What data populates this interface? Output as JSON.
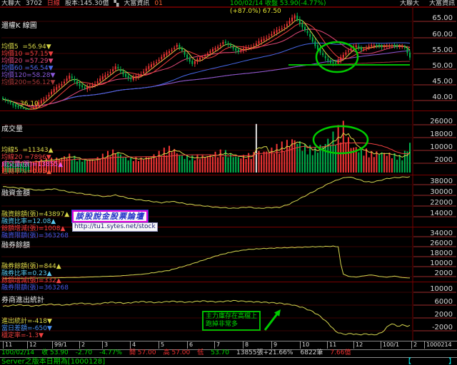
{
  "title_bar": {
    "stock_name": "大聯大",
    "stock_code": "3702",
    "period": "日線",
    "capital": "股本:145.30億",
    "vendor": "大富資訊",
    "session": "01",
    "date_close": "100/02/14 收盤 53.90(-4.77%)",
    "right_stock": "大聯大",
    "right_vendor": "大富資訊"
  },
  "main_panel": {
    "title": "還權K 線圖",
    "high_label": "(+87.0%) 67.50",
    "low_label": "36.10",
    "legend": [
      {
        "text": "均價5  =56.94▼",
        "color": "#d8d848"
      },
      {
        "text": "均價10 =57.15▼",
        "color": "#f04040"
      },
      {
        "text": "均價20 =57.29▼",
        "color": "#e04878"
      },
      {
        "text": "均價60 =56.54▼",
        "color": "#4868e8"
      },
      {
        "text": "均價120=58.28▼",
        "color": "#8858d8"
      },
      {
        "text": "均價200=56.12▼",
        "color": "#a83838"
      }
    ],
    "axis_labels": [
      "65.00",
      "60.00",
      "55.00",
      "50.00",
      "45.00",
      "40.00"
    ]
  },
  "volume_panel": {
    "title": "成交量",
    "legend": [
      {
        "text": "均線5  =11343▲",
        "color": "#d8d848"
      },
      {
        "text": "均線20 =7896▼",
        "color": "#f04040"
      },
      {
        "text": "成交量(張)=13855▲",
        "color": "#e858e8"
      },
      {
        "text": "週轉率%=0.95▲",
        "color": "#f05838"
      }
    ],
    "axis_labels": [
      "26000",
      "18000",
      "10000",
      "2000"
    ]
  },
  "margin_panel": {
    "title": "融資金額",
    "legend": [
      {
        "text": "融資餘額(張)=43897▲",
        "color": "#d8d848"
      },
      {
        "text": "融資比率=12.08▲",
        "color": "#58c8f0"
      },
      {
        "text": "餘額增減(張)=1008▲",
        "color": "#f04040"
      },
      {
        "text": "融資限額(張)=363268",
        "color": "#4858e8"
      }
    ],
    "axis_labels": [
      "38000",
      "30000",
      "22000",
      "14000"
    ]
  },
  "short_panel": {
    "title": "融券餘額",
    "legend": [
      {
        "text": "融券餘額(張)=844▲",
        "color": "#d8d848"
      },
      {
        "text": "融券比率=0.23▲",
        "color": "#58c8f0"
      },
      {
        "text": "餘額增減(張)=332▲",
        "color": "#f04040"
      },
      {
        "text": "融券限額(張)=363268",
        "color": "#4858e8"
      }
    ],
    "axis_labels": [
      "34000",
      "26000",
      "18000",
      "10000",
      "2000"
    ]
  },
  "broker_panel": {
    "title": "券商進出統計",
    "legend": [
      {
        "text": "進出統計=-418▼",
        "color": "#d8d848"
      },
      {
        "text": "當日差額=-650▼",
        "color": "#4890f0"
      },
      {
        "text": "穩定率=-1.3▼",
        "color": "#f04040"
      }
    ],
    "axis_labels": [
      "10000",
      "6000",
      "2000",
      "-2000"
    ]
  },
  "watermark": {
    "line1": "談股說金股票論壇",
    "url": "http://tu1.sytes.net/stock"
  },
  "annotation_note": {
    "line1": "主力庫存在高檔上",
    "line2": "跑掉非常多"
  },
  "xaxis_labels": [
    {
      "text": "11",
      "x": 4
    },
    {
      "text": "12",
      "x": 38
    },
    {
      "text": "99/1",
      "x": 73
    },
    {
      "text": "2",
      "x": 111
    },
    {
      "text": "3",
      "x": 143
    },
    {
      "text": "4",
      "x": 182
    },
    {
      "text": "5",
      "x": 222
    },
    {
      "text": "6",
      "x": 262
    },
    {
      "text": "7",
      "x": 300
    },
    {
      "text": "8",
      "x": 340
    },
    {
      "text": "9",
      "x": 380
    },
    {
      "text": "10",
      "x": 420
    },
    {
      "text": "11",
      "x": 458
    },
    {
      "text": "12",
      "x": 495
    },
    {
      "text": "100/1",
      "x": 533
    },
    {
      "text": "2",
      "x": 576
    },
    {
      "text": "1000214",
      "x": 594
    }
  ],
  "status_bar": [
    {
      "text": "100/02/14",
      "color": "#00d800"
    },
    {
      "text": "收 53.90",
      "color": "#00d800"
    },
    {
      "text": "-2.70",
      "color": "#00d800"
    },
    {
      "text": "-4.77%",
      "color": "#00d800"
    },
    {
      "text": "開 57.00",
      "color": "#f03030"
    },
    {
      "text": "高 57.00",
      "color": "#f03030"
    },
    {
      "text": "低",
      "color": "#f03030"
    },
    {
      "text": "53.70",
      "color": "#00d800"
    },
    {
      "text": "13855張+21.66%",
      "color": "#d0d0d0"
    },
    {
      "text": "6822筆",
      "color": "#d0d0d0"
    },
    {
      "text": "7.66億",
      "color": "#f03030"
    }
  ],
  "server_bar": {
    "text": "Server之版本日期為[1000128]",
    "brackets_open": "【",
    "brackets_close": "】"
  },
  "colors": {
    "up": "#f23535",
    "down": "#00b24e",
    "grid": "#3a0505",
    "separator": "#7a0000",
    "title_rule": "#c00000",
    "axis_underline": "#9e2c2c",
    "annotation": "#00cc00",
    "line_yellow": "#d8d850"
  },
  "chart_data": [
    {
      "type": "candlestick",
      "panel": "還權K線圖",
      "ylim": [
        40,
        65
      ],
      "x_range": "98/11 - 100/02/14",
      "high": 67.5,
      "low": 36.1,
      "last_close": 53.9,
      "close_keypoints": [
        [
          0,
          40.5
        ],
        [
          4,
          38.8
        ],
        [
          8,
          37.2
        ],
        [
          10,
          36.6
        ],
        [
          13,
          38.5
        ],
        [
          18,
          42.0
        ],
        [
          23,
          45.5
        ],
        [
          26,
          47.6
        ],
        [
          29,
          45.5
        ],
        [
          32,
          43.6
        ],
        [
          36,
          45.5
        ],
        [
          40,
          48.0
        ],
        [
          44,
          50.6
        ],
        [
          47,
          48.5
        ],
        [
          50,
          46.6
        ],
        [
          53,
          48.0
        ],
        [
          56,
          50.0
        ],
        [
          60,
          52.5
        ],
        [
          64,
          55.0
        ],
        [
          68,
          57.6
        ],
        [
          71,
          54.5
        ],
        [
          74,
          51.6
        ],
        [
          77,
          53.5
        ],
        [
          80,
          55.0
        ],
        [
          83,
          56.5
        ],
        [
          86,
          58.6
        ],
        [
          89,
          57.0
        ],
        [
          92,
          55.6
        ],
        [
          95,
          56.5
        ],
        [
          98,
          57.5
        ],
        [
          101,
          59.0
        ],
        [
          104,
          60.5
        ],
        [
          107,
          62.0
        ],
        [
          110,
          63.5
        ],
        [
          112,
          65.0
        ],
        [
          114,
          66.8
        ],
        [
          116,
          64.5
        ],
        [
          118,
          62.0
        ],
        [
          120,
          60.0
        ],
        [
          122,
          57.5
        ],
        [
          124,
          55.0
        ],
        [
          126,
          53.2
        ],
        [
          128,
          52.2
        ],
        [
          130,
          51.8
        ],
        [
          132,
          53.5
        ],
        [
          134,
          55.5
        ],
        [
          136,
          56.5
        ],
        [
          138,
          57.2
        ],
        [
          140,
          56.2
        ],
        [
          142,
          56.8
        ],
        [
          144,
          57.3
        ],
        [
          146,
          57.6
        ],
        [
          148,
          57.0
        ],
        [
          150,
          57.2
        ],
        [
          152,
          57.6
        ],
        [
          154,
          57.2
        ],
        [
          156,
          57.0
        ],
        [
          157,
          56.6
        ],
        [
          158,
          55.2
        ],
        [
          159,
          53.9
        ]
      ]
    },
    {
      "type": "bar",
      "panel": "成交量",
      "ylim": [
        2000,
        26000
      ],
      "last_volume": 13855,
      "highlight_bar_index": 99,
      "volume_keypoints": [
        [
          0,
          3000
        ],
        [
          8,
          2500
        ],
        [
          14,
          3500
        ],
        [
          20,
          4500
        ],
        [
          26,
          6500
        ],
        [
          30,
          3800
        ],
        [
          36,
          4200
        ],
        [
          44,
          9500
        ],
        [
          48,
          5000
        ],
        [
          54,
          4500
        ],
        [
          60,
          7000
        ],
        [
          66,
          11000
        ],
        [
          70,
          6000
        ],
        [
          74,
          5200
        ],
        [
          80,
          6500
        ],
        [
          86,
          8500
        ],
        [
          92,
          5500
        ],
        [
          98,
          7000
        ],
        [
          99,
          26500
        ],
        [
          100,
          8000
        ],
        [
          104,
          9500
        ],
        [
          110,
          12500
        ],
        [
          114,
          16500
        ],
        [
          118,
          11000
        ],
        [
          122,
          9500
        ],
        [
          126,
          14500
        ],
        [
          130,
          18500
        ],
        [
          133,
          22500
        ],
        [
          136,
          12500
        ],
        [
          140,
          9800
        ],
        [
          144,
          7500
        ],
        [
          148,
          8500
        ],
        [
          152,
          6800
        ],
        [
          156,
          5200
        ],
        [
          159,
          13855
        ]
      ]
    },
    {
      "type": "line",
      "panel": "融資金額",
      "ylim": [
        14000,
        38000
      ],
      "last_value": 43897,
      "keypoints": [
        [
          0,
          36500
        ],
        [
          8,
          35200
        ],
        [
          14,
          33800
        ],
        [
          20,
          34800
        ],
        [
          26,
          32500
        ],
        [
          34,
          30500
        ],
        [
          40,
          29000
        ],
        [
          44,
          30200
        ],
        [
          50,
          27500
        ],
        [
          56,
          26000
        ],
        [
          62,
          24500
        ],
        [
          66,
          25500
        ],
        [
          72,
          23500
        ],
        [
          78,
          22200
        ],
        [
          84,
          21000
        ],
        [
          90,
          20300
        ],
        [
          96,
          21200
        ],
        [
          100,
          20200
        ],
        [
          104,
          20800
        ],
        [
          108,
          21000
        ],
        [
          112,
          23500
        ],
        [
          116,
          27500
        ],
        [
          120,
          31500
        ],
        [
          124,
          35500
        ],
        [
          128,
          39500
        ],
        [
          132,
          42500
        ],
        [
          135,
          43800
        ],
        [
          138,
          42500
        ],
        [
          141,
          40500
        ],
        [
          144,
          39800
        ],
        [
          147,
          41000
        ],
        [
          150,
          42500
        ],
        [
          153,
          43200
        ],
        [
          156,
          43600
        ],
        [
          159,
          43897
        ]
      ]
    },
    {
      "type": "line",
      "panel": "融券餘額",
      "ylim": [
        2000,
        34000
      ],
      "last_value": 844,
      "keypoints": [
        [
          0,
          600
        ],
        [
          15,
          900
        ],
        [
          30,
          1400
        ],
        [
          45,
          2500
        ],
        [
          55,
          4000
        ],
        [
          65,
          7000
        ],
        [
          72,
          11000
        ],
        [
          78,
          15000
        ],
        [
          84,
          19000
        ],
        [
          90,
          22000
        ],
        [
          96,
          23800
        ],
        [
          102,
          24500
        ],
        [
          108,
          25000
        ],
        [
          114,
          25400
        ],
        [
          120,
          25800
        ],
        [
          125,
          26100
        ],
        [
          129,
          26300
        ],
        [
          131,
          26000
        ],
        [
          132,
          12000
        ],
        [
          133,
          4000
        ],
        [
          135,
          2200
        ],
        [
          138,
          1600
        ],
        [
          141,
          2600
        ],
        [
          144,
          3400
        ],
        [
          147,
          2200
        ],
        [
          150,
          1500
        ],
        [
          153,
          2400
        ],
        [
          156,
          1300
        ],
        [
          159,
          844
        ]
      ]
    },
    {
      "type": "line",
      "panel": "券商進出統計",
      "ylim": [
        -2000,
        10000
      ],
      "last_value": -418,
      "keypoints": [
        [
          0,
          5600
        ],
        [
          6,
          6100
        ],
        [
          12,
          5700
        ],
        [
          18,
          6300
        ],
        [
          24,
          6000
        ],
        [
          30,
          6600
        ],
        [
          36,
          6300
        ],
        [
          42,
          6900
        ],
        [
          48,
          6600
        ],
        [
          54,
          7100
        ],
        [
          60,
          6800
        ],
        [
          66,
          7200
        ],
        [
          72,
          6900
        ],
        [
          78,
          7300
        ],
        [
          84,
          7000
        ],
        [
          90,
          7400
        ],
        [
          96,
          7100
        ],
        [
          102,
          6900
        ],
        [
          108,
          6600
        ],
        [
          113,
          6100
        ],
        [
          117,
          5300
        ],
        [
          121,
          4000
        ],
        [
          124,
          2500
        ],
        [
          127,
          400
        ],
        [
          130,
          -2200
        ],
        [
          133,
          -3100
        ],
        [
          136,
          -2900
        ],
        [
          139,
          -3200
        ],
        [
          142,
          -3000
        ],
        [
          145,
          -3300
        ],
        [
          148,
          -2600
        ],
        [
          150,
          -900
        ],
        [
          152,
          300
        ],
        [
          154,
          -600
        ],
        [
          156,
          -200
        ],
        [
          158,
          -500
        ],
        [
          159,
          -418
        ]
      ]
    }
  ],
  "overlay_annotations": {
    "ellipse_price": {
      "cx": 472,
      "cy": 80,
      "rx": 29,
      "ry": 21
    },
    "ellipse_volume": {
      "cx": 477,
      "cy": 196,
      "rx": 38,
      "ry": 19
    },
    "support_line": {
      "x1": 404,
      "x2": 574,
      "y": 91
    },
    "arrow": {
      "x1": 371,
      "y1": 463,
      "x2": 393,
      "y2": 434
    }
  }
}
